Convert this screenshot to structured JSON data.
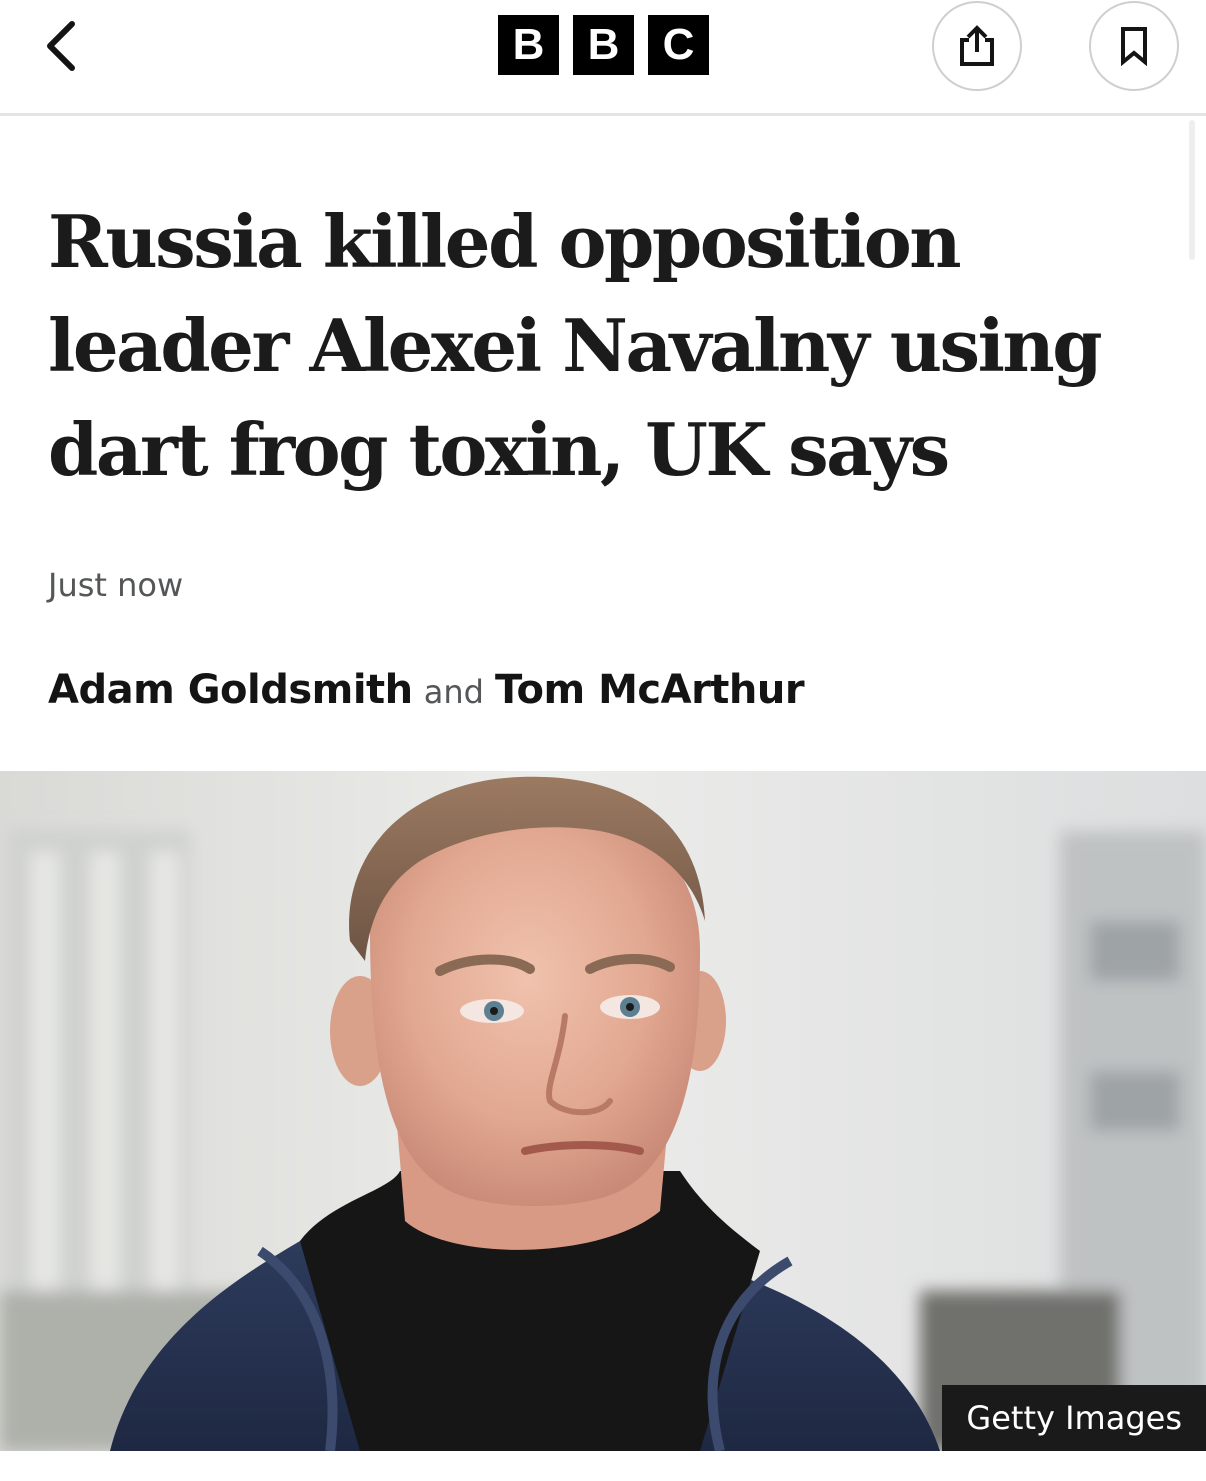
{
  "header": {
    "back_icon": "chevron-left-icon",
    "logo_letters": [
      "B",
      "B",
      "C"
    ],
    "share_icon": "share-icon",
    "bookmark_icon": "bookmark-icon"
  },
  "article": {
    "headline": "Russia killed opposition leader Alexei Navalny using dart frog toxin, UK says",
    "timestamp": "Just now",
    "authors": [
      "Adam Goldsmith",
      "Tom McArthur"
    ],
    "author_separator": "and",
    "image_credit": "Getty Images"
  }
}
